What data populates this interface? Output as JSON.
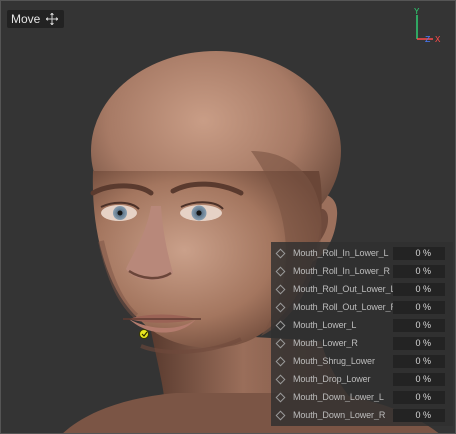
{
  "toolbar": {
    "mode_label": "Move",
    "mode_icon": "move-crosshair-icon"
  },
  "axis_gizmo": {
    "y_label": "Y",
    "z_label": "Z",
    "x_label": "X",
    "colors": {
      "y": "#2ecc71",
      "z": "#4a7bff",
      "x": "#ff4a4a"
    }
  },
  "morph_panel": {
    "rows": [
      {
        "name": "Mouth_Roll_In_Lower_L",
        "value": "0 %"
      },
      {
        "name": "Mouth_Roll_In_Lower_R",
        "value": "0 %"
      },
      {
        "name": "Mouth_Roll_Out_Lower_L",
        "value": "0 %"
      },
      {
        "name": "Mouth_Roll_Out_Lower_R",
        "value": "0 %"
      },
      {
        "name": "Mouth_Lower_L",
        "value": "0 %"
      },
      {
        "name": "Mouth_Lower_R",
        "value": "0 %"
      },
      {
        "name": "Mouth_Shrug_Lower",
        "value": "0 %"
      },
      {
        "name": "Mouth_Drop_Lower",
        "value": "0 %"
      },
      {
        "name": "Mouth_Down_Lower_L",
        "value": "0 %"
      },
      {
        "name": "Mouth_Down_Lower_R",
        "value": "0 %"
      }
    ]
  }
}
